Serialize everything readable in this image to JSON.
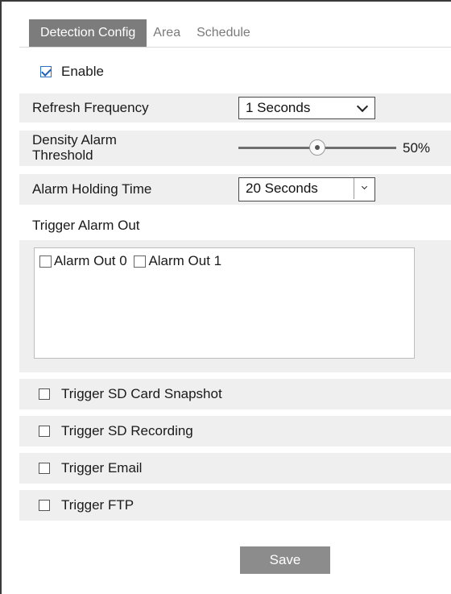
{
  "tabs": [
    "Detection Config",
    "Area",
    "Schedule"
  ],
  "enable": {
    "label": "Enable",
    "checked": true
  },
  "refresh_frequency": {
    "label": "Refresh Frequency",
    "value": "1 Seconds"
  },
  "density_threshold": {
    "label_line1": "Density Alarm",
    "label_line2": "Threshold",
    "value_text": "50%",
    "value": 50
  },
  "alarm_holding": {
    "label": "Alarm Holding Time",
    "value": "20 Seconds"
  },
  "trigger_alarm_out": {
    "label": "Trigger Alarm Out",
    "options": [
      "Alarm Out 0",
      "Alarm Out 1"
    ]
  },
  "triggers": [
    "Trigger SD Card Snapshot",
    "Trigger SD Recording",
    "Trigger Email",
    "Trigger FTP"
  ],
  "save_label": "Save"
}
